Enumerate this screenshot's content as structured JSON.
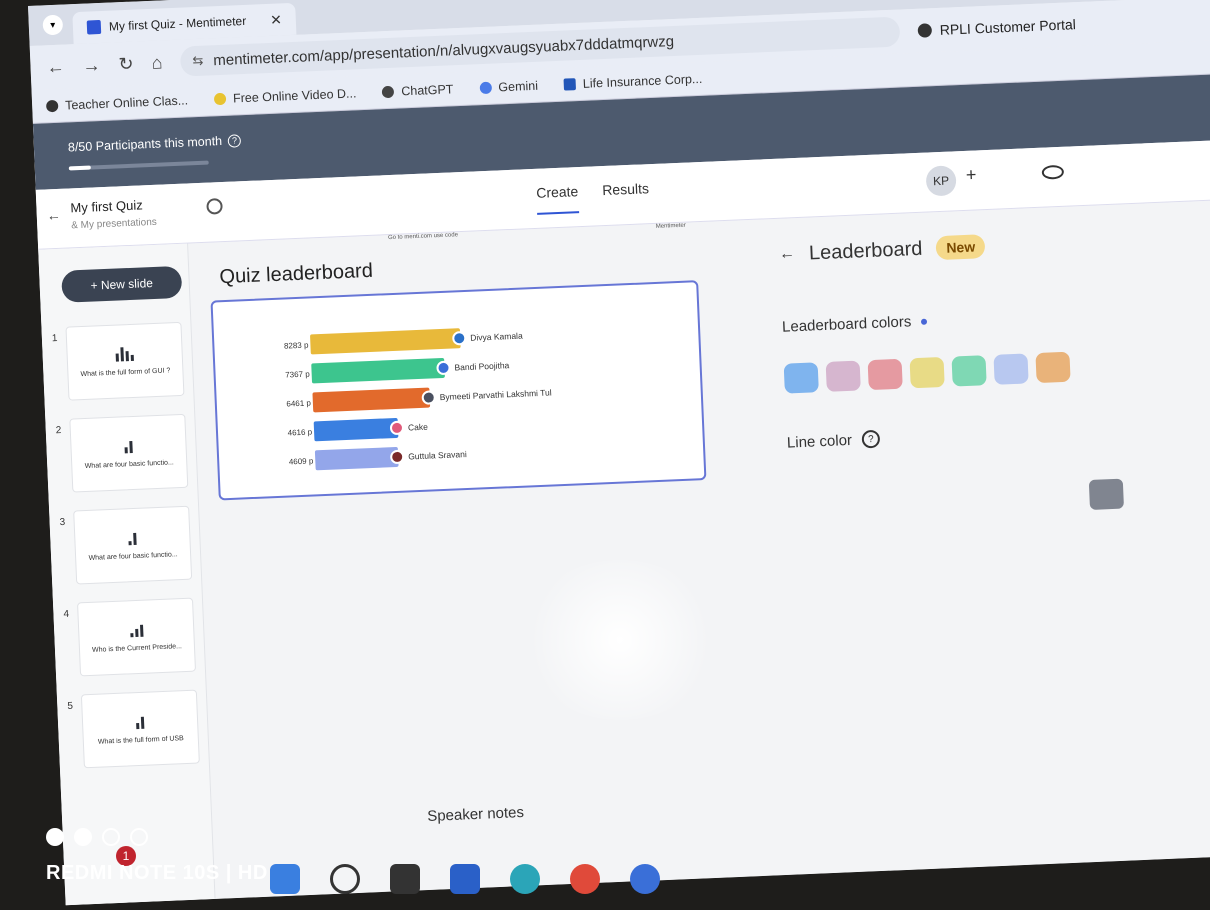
{
  "browser": {
    "tab_title": "My first Quiz - Mentimeter",
    "url": "mentimeter.com/app/presentation/n/alvugxvaugsyuabx7dddatmqrwzg",
    "portal": "RPLI Customer Portal",
    "bookmarks": [
      "Teacher Online Clas...",
      "Free Online Video D...",
      "ChatGPT",
      "Gemini",
      "Life Insurance Corp..."
    ]
  },
  "app": {
    "participants": "8/50  Participants this month",
    "participants_fraction": 0.16,
    "presentation_title": "My first Quiz",
    "presentation_sub": "& My presentations",
    "tabs": [
      "Create",
      "Results"
    ],
    "user_initials": "KP",
    "new_slide_label": "+ New slide",
    "slides": [
      {
        "num": "1",
        "caption": "What is the full form of GUI ?"
      },
      {
        "num": "2",
        "caption": "What are four basic functio..."
      },
      {
        "num": "3",
        "caption": "What are four basic functio..."
      },
      {
        "num": "4",
        "caption": "Who is the Current Preside..."
      },
      {
        "num": "5",
        "caption": "What is the full form of USB"
      }
    ],
    "canvas": {
      "title": "Quiz leaderboard",
      "join_text": "Go to menti.com use code",
      "brand": "Mentimeter",
      "leaderboard": [
        {
          "score": "8283 p",
          "name": "Divya Kamala",
          "value": 8283,
          "color": "#e8b93a",
          "avatar": "#2a70c8"
        },
        {
          "score": "7367 p",
          "name": "Bandi Poojitha",
          "value": 7367,
          "color": "#3dc58e",
          "avatar": "#3a6fd8"
        },
        {
          "score": "6461 p",
          "name": "Bymeeti Parvathi Lakshmi Tul",
          "value": 6461,
          "color": "#e26a2c",
          "avatar": "#4a5060"
        },
        {
          "score": "4616 p",
          "name": "Cake",
          "value": 4616,
          "color": "#3a7fe0",
          "avatar": "#e05a7a"
        },
        {
          "score": "4609 p",
          "name": "Guttula Sravani",
          "value": 4609,
          "color": "#93a6ea",
          "avatar": "#7a2a2a"
        }
      ]
    },
    "speaker_notes": "Speaker notes"
  },
  "panel": {
    "title": "Leaderboard",
    "badge": "New",
    "colors_label": "Leaderboard colors",
    "swatches": [
      "#7fb4ee",
      "#d6b6cf",
      "#e59aa1",
      "#e8db86",
      "#7fd8b4",
      "#b8c8f0",
      "#e9b37a"
    ],
    "line_color_label": "Line color"
  },
  "camera": {
    "watermark": "REDMI NOTE 10S | HD",
    "notification": "1"
  }
}
